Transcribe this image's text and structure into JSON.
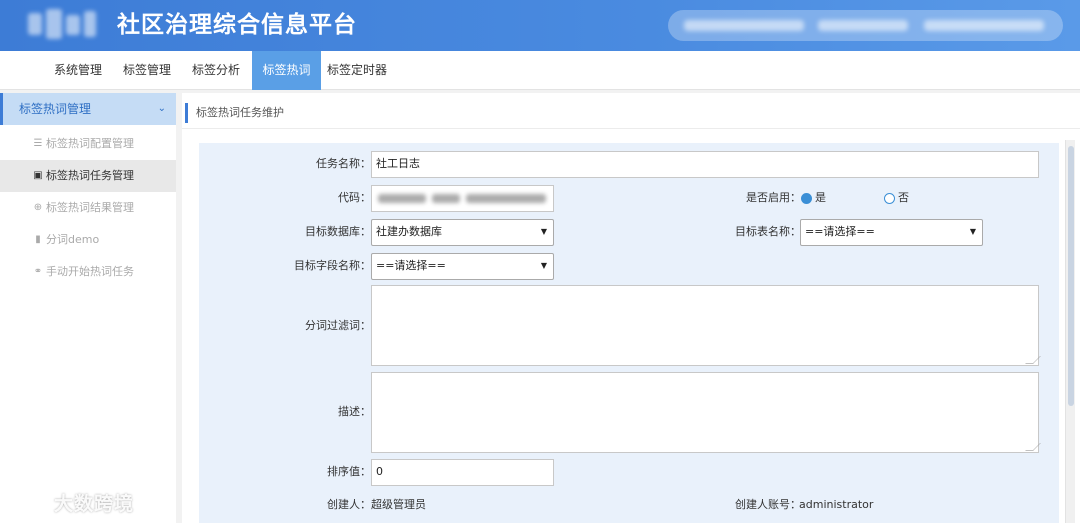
{
  "header": {
    "app_title": "社区治理综合信息平台"
  },
  "topnav": {
    "items": [
      {
        "label": "系统管理"
      },
      {
        "label": "标签管理"
      },
      {
        "label": "标签分析"
      },
      {
        "label": "标签热词",
        "active": true
      },
      {
        "label": "标签定时器"
      }
    ]
  },
  "sidebar": {
    "group_label": "标签热词管理",
    "items": [
      {
        "icon": "list-icon",
        "label": "标签热词配置管理"
      },
      {
        "icon": "cube-icon",
        "label": "标签热词任务管理",
        "active": true
      },
      {
        "icon": "globe-icon",
        "label": "标签热词结果管理"
      },
      {
        "icon": "bookmark-icon",
        "label": "分词demo"
      },
      {
        "icon": "link-icon",
        "label": "手动开始热词任务"
      }
    ]
  },
  "breadcrumb": "标签热词任务维护",
  "form": {
    "task_name_label": "任务名称：",
    "task_name_value": "社工日志",
    "code_label": "代码：",
    "enabled_label": "是否启用：",
    "enabled_yes": "是",
    "enabled_no": "否",
    "enabled_value": "是",
    "target_db_label": "目标数据库：",
    "target_db_value": "社建办数据库",
    "target_table_label": "目标表名称：",
    "target_table_value": "==请选择==",
    "target_field_label": "目标字段名称：",
    "target_field_value": "==请选择==",
    "filter_words_label": "分词过滤词：",
    "filter_words_value": "",
    "description_label": "描述：",
    "description_value": "",
    "sort_label": "排序值：",
    "sort_value": "0",
    "creator_label": "创建人：",
    "creator_value": "超级管理员",
    "creator_account_label": "创建人账号：",
    "creator_account_value": "administrator"
  },
  "watermark": "大数跨境",
  "colors": {
    "header": "#4a8be0",
    "nav_active": "#5a9fe6",
    "sidebar_active_group": "#c5dcf5",
    "form_panel": "#e9f1fb",
    "radio": "#3b8fd6"
  }
}
